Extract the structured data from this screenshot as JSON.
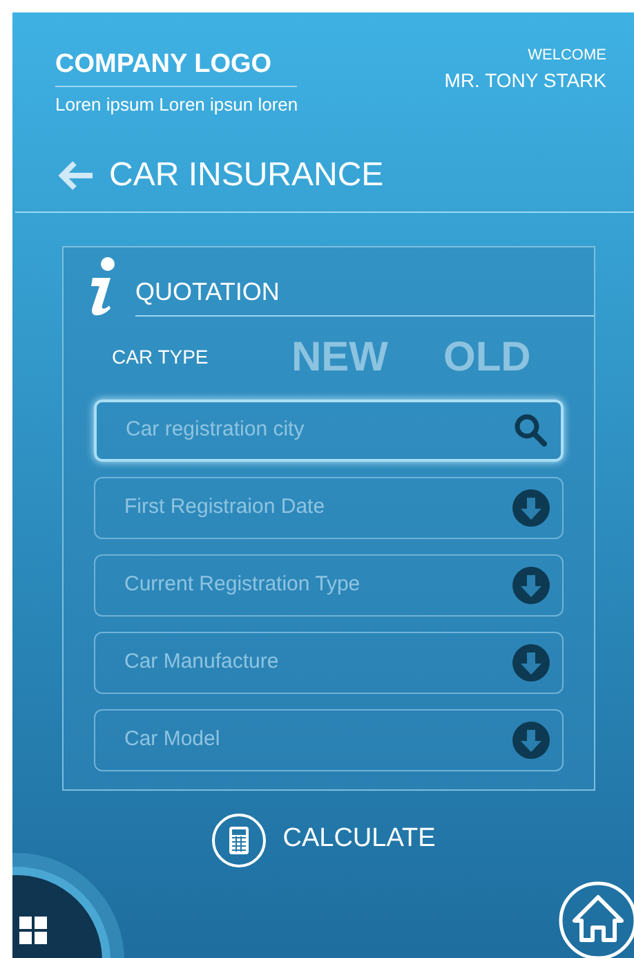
{
  "header": {
    "logo": "COMPANY LOGO",
    "tagline": "Loren ipsum Loren ipsun loren",
    "welcome": "WELCOME",
    "user": "MR. TONY STARK"
  },
  "page_title": "CAR INSURANCE",
  "card": {
    "title": "QUOTATION",
    "car_type": {
      "label": "CAR TYPE",
      "options": [
        {
          "label": "NEW",
          "selected": false
        },
        {
          "label": "OLD",
          "selected": false
        }
      ]
    },
    "fields": [
      {
        "kind": "search",
        "placeholder": "Car registration city",
        "focused": true
      },
      {
        "kind": "dropdown",
        "placeholder": "First Registraion Date",
        "focused": false
      },
      {
        "kind": "dropdown",
        "placeholder": "Current Registration Type",
        "focused": false
      },
      {
        "kind": "dropdown",
        "placeholder": "Car Manufacture",
        "focused": false
      },
      {
        "kind": "dropdown",
        "placeholder": "Car Model",
        "focused": false
      }
    ]
  },
  "calculate": "CALCULATE"
}
